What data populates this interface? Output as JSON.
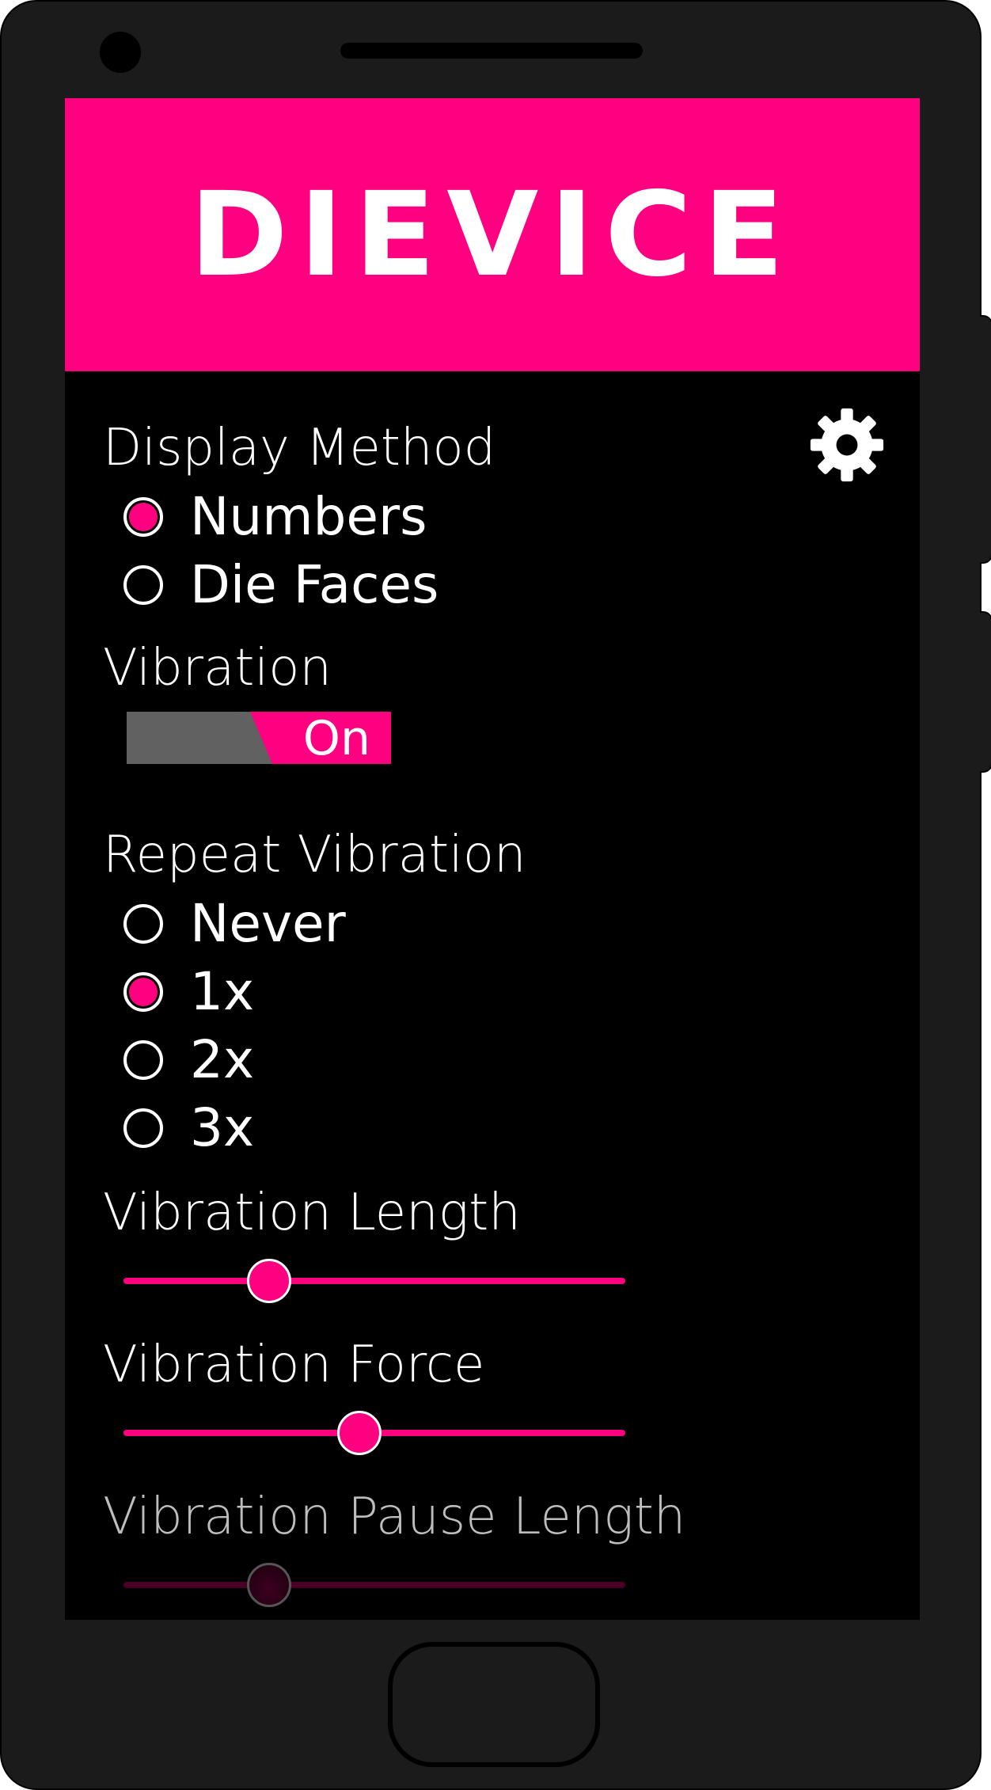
{
  "app": {
    "title": "DIEVICE"
  },
  "display_method": {
    "label": "Display Method",
    "options": [
      {
        "label": "Numbers",
        "selected": true
      },
      {
        "label": "Die Faces",
        "selected": false
      }
    ]
  },
  "settings": {
    "icon": "gear-icon"
  },
  "vibration": {
    "label": "Vibration",
    "toggle_state": "On",
    "enabled": true
  },
  "repeat_vibration": {
    "label": "Repeat Vibration",
    "options": [
      {
        "label": "Never",
        "selected": false
      },
      {
        "label": "1x",
        "selected": true
      },
      {
        "label": "2x",
        "selected": false
      },
      {
        "label": "3x",
        "selected": false
      }
    ]
  },
  "sliders": {
    "vibration_length": {
      "label": "Vibration Length",
      "value": 0.29,
      "enabled": true
    },
    "vibration_force": {
      "label": "Vibration Force",
      "value": 0.47,
      "enabled": true
    },
    "vibration_pause_length": {
      "label": "Vibration Pause Length",
      "value": 0.29,
      "enabled": false
    }
  },
  "colors": {
    "accent": "#ff0080",
    "background": "#000000",
    "phone_body": "#1b1b1b",
    "toggle_off": "#616161"
  }
}
